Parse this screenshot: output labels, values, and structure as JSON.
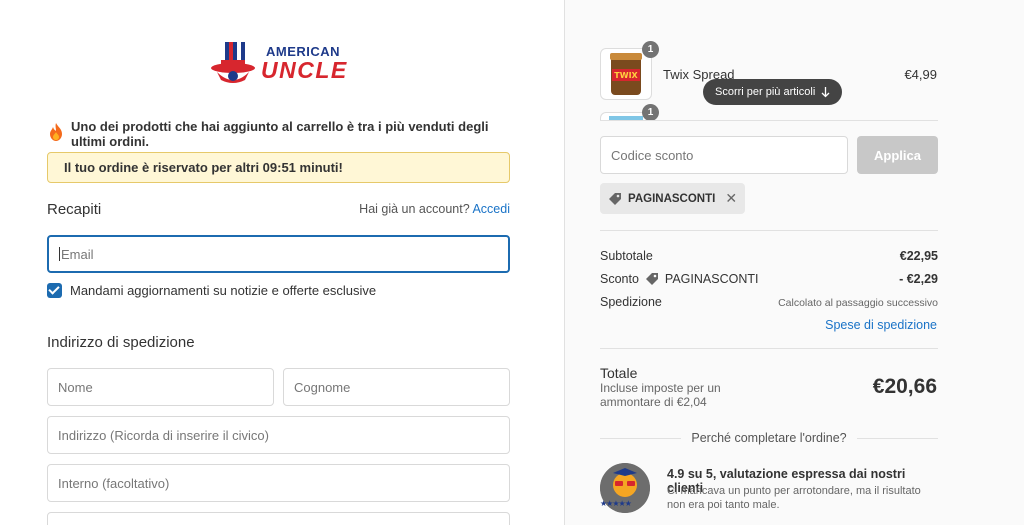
{
  "brand": {
    "line1": "AMERICAN",
    "line2": "UNCLE"
  },
  "alerts": {
    "hot_product": "Uno dei prodotti che hai aggiunto al carrello è tra i più venduti degli ultimi ordini.",
    "reserved": "Il tuo ordine è riservato per altri 09:51 minuti!"
  },
  "contact": {
    "title": "Recapiti",
    "have_account": "Hai già un account?",
    "login_link": "Accedi",
    "email_placeholder": "Email",
    "newsletter_label": "Mandami aggiornamenti su notizie e offerte esclusive",
    "newsletter_checked": true
  },
  "shipping": {
    "title": "Indirizzo di spedizione",
    "first_name_placeholder": "Nome",
    "last_name_placeholder": "Cognome",
    "address_placeholder": "Indirizzo (Ricorda di inserire il civico)",
    "apt_placeholder": "Interno (facoltativo)"
  },
  "cart": {
    "items": [
      {
        "name": "Twix Spread",
        "price": "€4,99",
        "qty": "1",
        "thumb_text": "TWIX"
      },
      {
        "name": "",
        "price": "",
        "qty": "1"
      }
    ],
    "scroll_hint": "Scorri per più articoli"
  },
  "discount": {
    "placeholder": "Codice sconto",
    "apply_label": "Applica",
    "applied_code": "PAGINASCONTI"
  },
  "summary": {
    "subtotal_label": "Subtotale",
    "subtotal_value": "€22,95",
    "discount_label": "Sconto",
    "discount_code": "PAGINASCONTI",
    "discount_value": "- €2,29",
    "shipping_label": "Spedizione",
    "shipping_value": "Calcolato al passaggio successivo",
    "shipping_link": "Spese di spedizione",
    "total_label": "Totale",
    "total_taxes": "Incluse imposte per un ammontare di €2,04",
    "total_value": "€20,66"
  },
  "why": {
    "title": "Perché completare l'ordine?",
    "review_head": "4.9 su 5, valutazione espressa dai nostri clienti",
    "review_body": "Ci mancava un punto per arrotondare, ma il risultato non era poi tanto male.",
    "stars": "★★★★★"
  },
  "colors": {
    "accent": "#1c6bb0",
    "link": "#1a73c7",
    "brand_red": "#d7262e",
    "brand_blue": "#1e3a8a",
    "reserve_bg": "#fff7d6"
  }
}
